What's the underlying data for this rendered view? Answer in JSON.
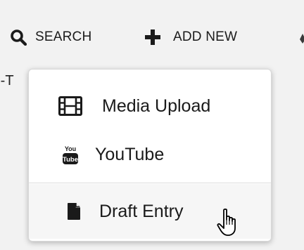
{
  "toolbar": {
    "search_label": "Search",
    "search_icon": "search-icon",
    "add_label": "Add New",
    "add_icon": "plus-icon"
  },
  "background": {
    "partial_text": ")-T"
  },
  "dropdown": {
    "items": [
      {
        "label": "Media Upload",
        "icon": "film-icon"
      },
      {
        "label": "YouTube",
        "icon": "youtube-icon"
      },
      {
        "label": "Draft Entry",
        "icon": "document-icon"
      }
    ]
  },
  "colors": {
    "text": "#1a1a1a",
    "background": "#f2f2f2",
    "menu_background": "#ffffff",
    "hover_background": "#f6f6f6"
  }
}
